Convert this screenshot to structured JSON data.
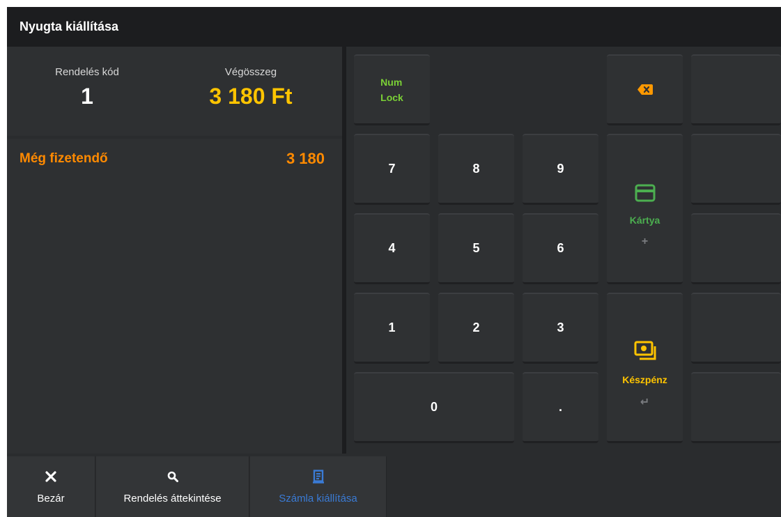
{
  "title": "Nyugta kiállítása",
  "summary": {
    "order_code_label": "Rendelés kód",
    "order_code": "1",
    "total_label": "Végösszeg",
    "total_value": "3 180 Ft"
  },
  "due": {
    "label": "Még fizetendő",
    "value": "3 180"
  },
  "keypad": {
    "numlock_line1": "Num",
    "numlock_line2": "Lock",
    "keys": [
      "7",
      "8",
      "9",
      "4",
      "5",
      "6",
      "1",
      "2",
      "3",
      "0",
      "."
    ],
    "backspace_icon": "backspace-icon"
  },
  "payment": {
    "card_label": "Kártya",
    "card_icon": "credit-card-icon",
    "card_sub": "+",
    "cash_label": "Készpénz",
    "cash_icon": "cash-icon",
    "cash_sub": "↵"
  },
  "bottom": {
    "close_label": "Bezár",
    "close_icon": "close-icon",
    "review_label": "Rendelés áttekintése",
    "review_icon": "search-icon",
    "invoice_label": "Számla kiállítása",
    "invoice_icon": "receipt-icon"
  },
  "colors": {
    "accent_yellow": "#ffc400",
    "accent_orange": "#ff8a00",
    "accent_green": "#4caf50",
    "numlock_green": "#7bd136",
    "active_blue": "#3a7bd5",
    "backspace_orange": "#ff9800"
  }
}
